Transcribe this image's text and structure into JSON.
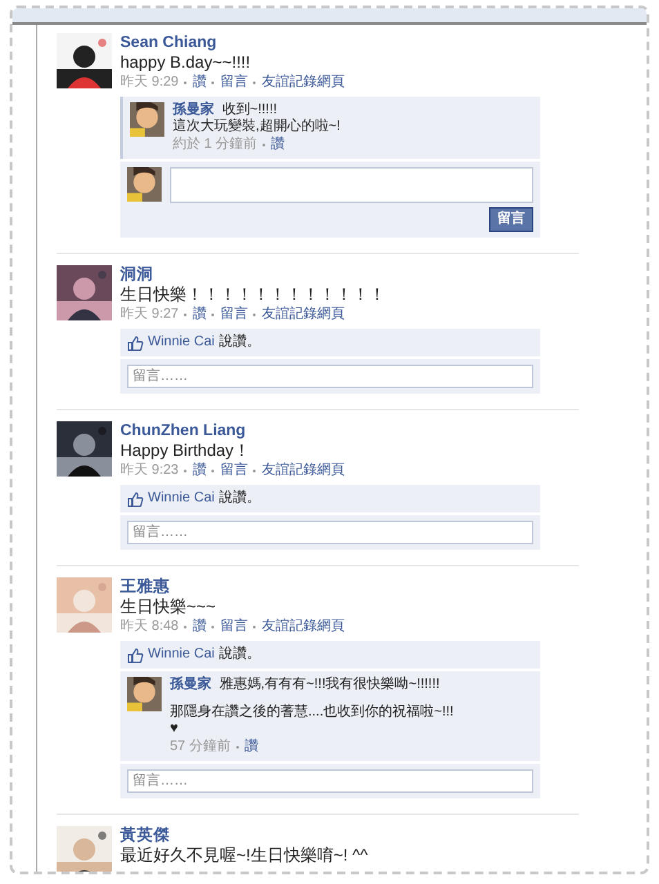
{
  "posts": [
    {
      "author": "Sean Chiang",
      "avatar": {
        "kind": "picture"
      },
      "message": "happy B.day~~!!!!",
      "time": "昨天 9:29",
      "actions": [
        "讚",
        "留言",
        "友誼記錄網頁"
      ],
      "comments": [
        {
          "author": "孫曼家",
          "paragraphs": [
            [
              "收到~!!!!!",
              "這次大玩變裝,超開心的啦~!"
            ]
          ],
          "time": "約於 1 分鐘前",
          "like": "讚"
        }
      ],
      "composer": {
        "kind": "expanded",
        "button": "留言"
      }
    },
    {
      "author": "洞洞",
      "avatar": {
        "kind": "picture"
      },
      "message": "生日快樂！！！！！！！！！！！！",
      "time": "昨天 9:27",
      "actions": [
        "讚",
        "留言",
        "友誼記錄網頁"
      ],
      "likes": {
        "name": "Winnie Cai",
        "suffix": "說讚。"
      },
      "composer": {
        "kind": "compact",
        "placeholder": "留言……"
      }
    },
    {
      "author": "ChunZhen Liang",
      "avatar": {
        "kind": "picture"
      },
      "message": "Happy Birthday！",
      "time": "昨天 9:23",
      "actions": [
        "讚",
        "留言",
        "友誼記錄網頁"
      ],
      "likes": {
        "name": "Winnie Cai",
        "suffix": "說讚。"
      },
      "composer": {
        "kind": "compact",
        "placeholder": "留言……"
      }
    },
    {
      "author": "王雅惠",
      "avatar": {
        "kind": "picture"
      },
      "message": "生日快樂~~~",
      "time": "昨天 8:48",
      "actions": [
        "讚",
        "留言",
        "友誼記錄網頁"
      ],
      "likes": {
        "name": "Winnie Cai",
        "suffix": "說讚。"
      },
      "comments": [
        {
          "author": "孫曼家",
          "paragraphs": [
            [
              "雅惠媽,有有有~!!!我有很快樂呦~!!!!!!"
            ],
            [
              "那隱身在讚之後的蓍慧....也收到你的祝福啦~!!!",
              "♥"
            ]
          ],
          "time": "57 分鐘前",
          "like": "讚"
        }
      ],
      "composer": {
        "kind": "compact",
        "placeholder": "留言……"
      }
    },
    {
      "author": "黃英傑",
      "avatar": {
        "kind": "picture"
      },
      "message": "最近好久不見喔~!生日快樂唷~! ^^"
    }
  ]
}
